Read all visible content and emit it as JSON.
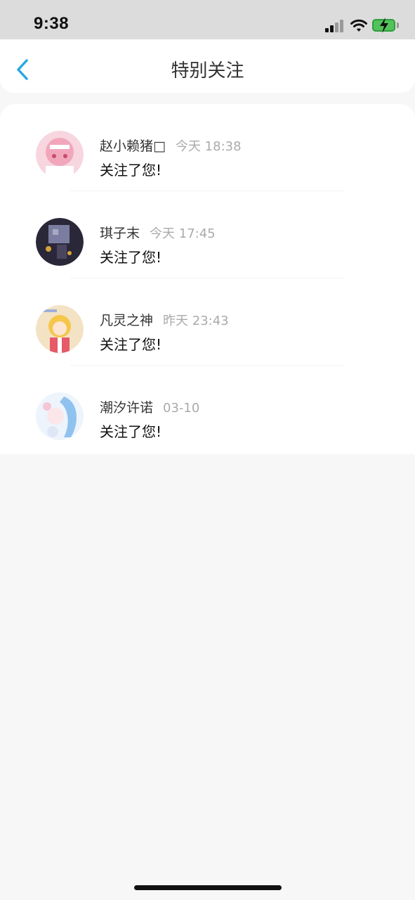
{
  "status_bar": {
    "time": "9:38",
    "icons": [
      "cellular-signal-icon",
      "wifi-icon",
      "battery-charging-icon"
    ],
    "battery_color": "#52c35a"
  },
  "nav": {
    "back_icon": "chevron-left-icon",
    "back_color": "#2aa7e0",
    "title": "特别关注"
  },
  "items": [
    {
      "name": "赵小赖猪□",
      "time": "今天 18:38",
      "message": "关注了您!",
      "avatar_colors": [
        "#f7d6df",
        "#f2a6bc",
        "#ffffff"
      ]
    },
    {
      "name": "琪子末",
      "time": "今天 17:45",
      "message": "关注了您!",
      "avatar_colors": [
        "#2a2838",
        "#7b7da0",
        "#d7a23a"
      ]
    },
    {
      "name": "凡灵之神",
      "time": "昨天 23:43",
      "message": "关注了您!",
      "avatar_colors": [
        "#f3e3c4",
        "#f5c64a",
        "#e65a6a"
      ]
    },
    {
      "name": "潮汐许诺",
      "time": "03-10",
      "message": "关注了您!",
      "avatar_colors": [
        "#eef4fb",
        "#8fc2ee",
        "#f4c6d6"
      ]
    }
  ]
}
